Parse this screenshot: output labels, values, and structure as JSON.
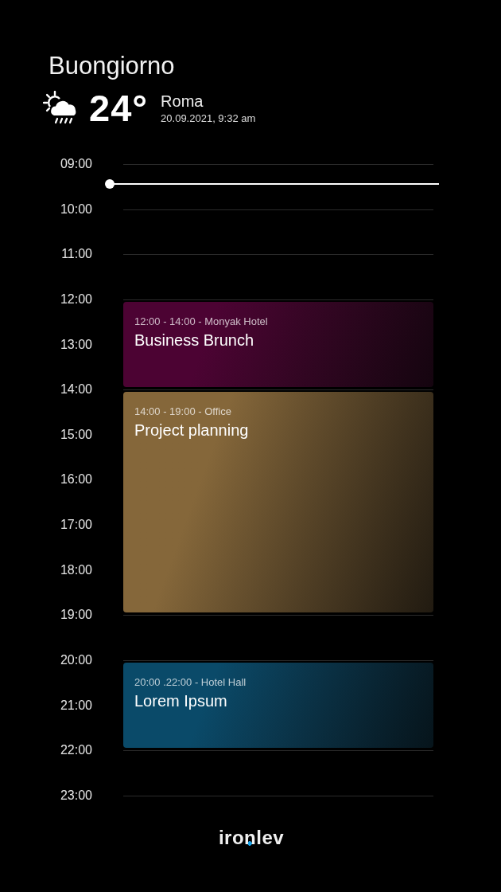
{
  "greeting": "Buongiorno",
  "weather": {
    "temperature": "24°",
    "city": "Roma",
    "datetime": "20.09.2021, 9:32 am"
  },
  "timeline": {
    "hours": [
      {
        "label": "09:00",
        "current": true
      },
      {
        "label": "10:00",
        "current": false
      },
      {
        "label": "11:00",
        "current": false
      },
      {
        "label": "12:00",
        "current": false
      },
      {
        "label": "13:00",
        "current": false
      },
      {
        "label": "14:00",
        "current": false
      },
      {
        "label": "15:00",
        "current": false
      },
      {
        "label": "16:00",
        "current": false
      },
      {
        "label": "17:00",
        "current": false
      },
      {
        "label": "18:00",
        "current": false
      },
      {
        "label": "19:00",
        "current": false
      },
      {
        "label": "20:00",
        "current": false
      },
      {
        "label": "21:00",
        "current": false
      },
      {
        "label": "22:00",
        "current": false
      },
      {
        "label": "23:00",
        "current": false
      }
    ],
    "events": [
      {
        "time": "12:00 - 14:00 - Monyak Hotel",
        "title": "Business Brunch",
        "color": "#4c0333"
      },
      {
        "time": "14:00 - 19:00 - Office",
        "title": "Project planning",
        "color": "#85673a"
      },
      {
        "time": "20:00 .22:00 - Hotel Hall",
        "title": "Lorem Ipsum",
        "color": "#0a4a69"
      }
    ]
  },
  "logo": {
    "text": "ironlev"
  }
}
